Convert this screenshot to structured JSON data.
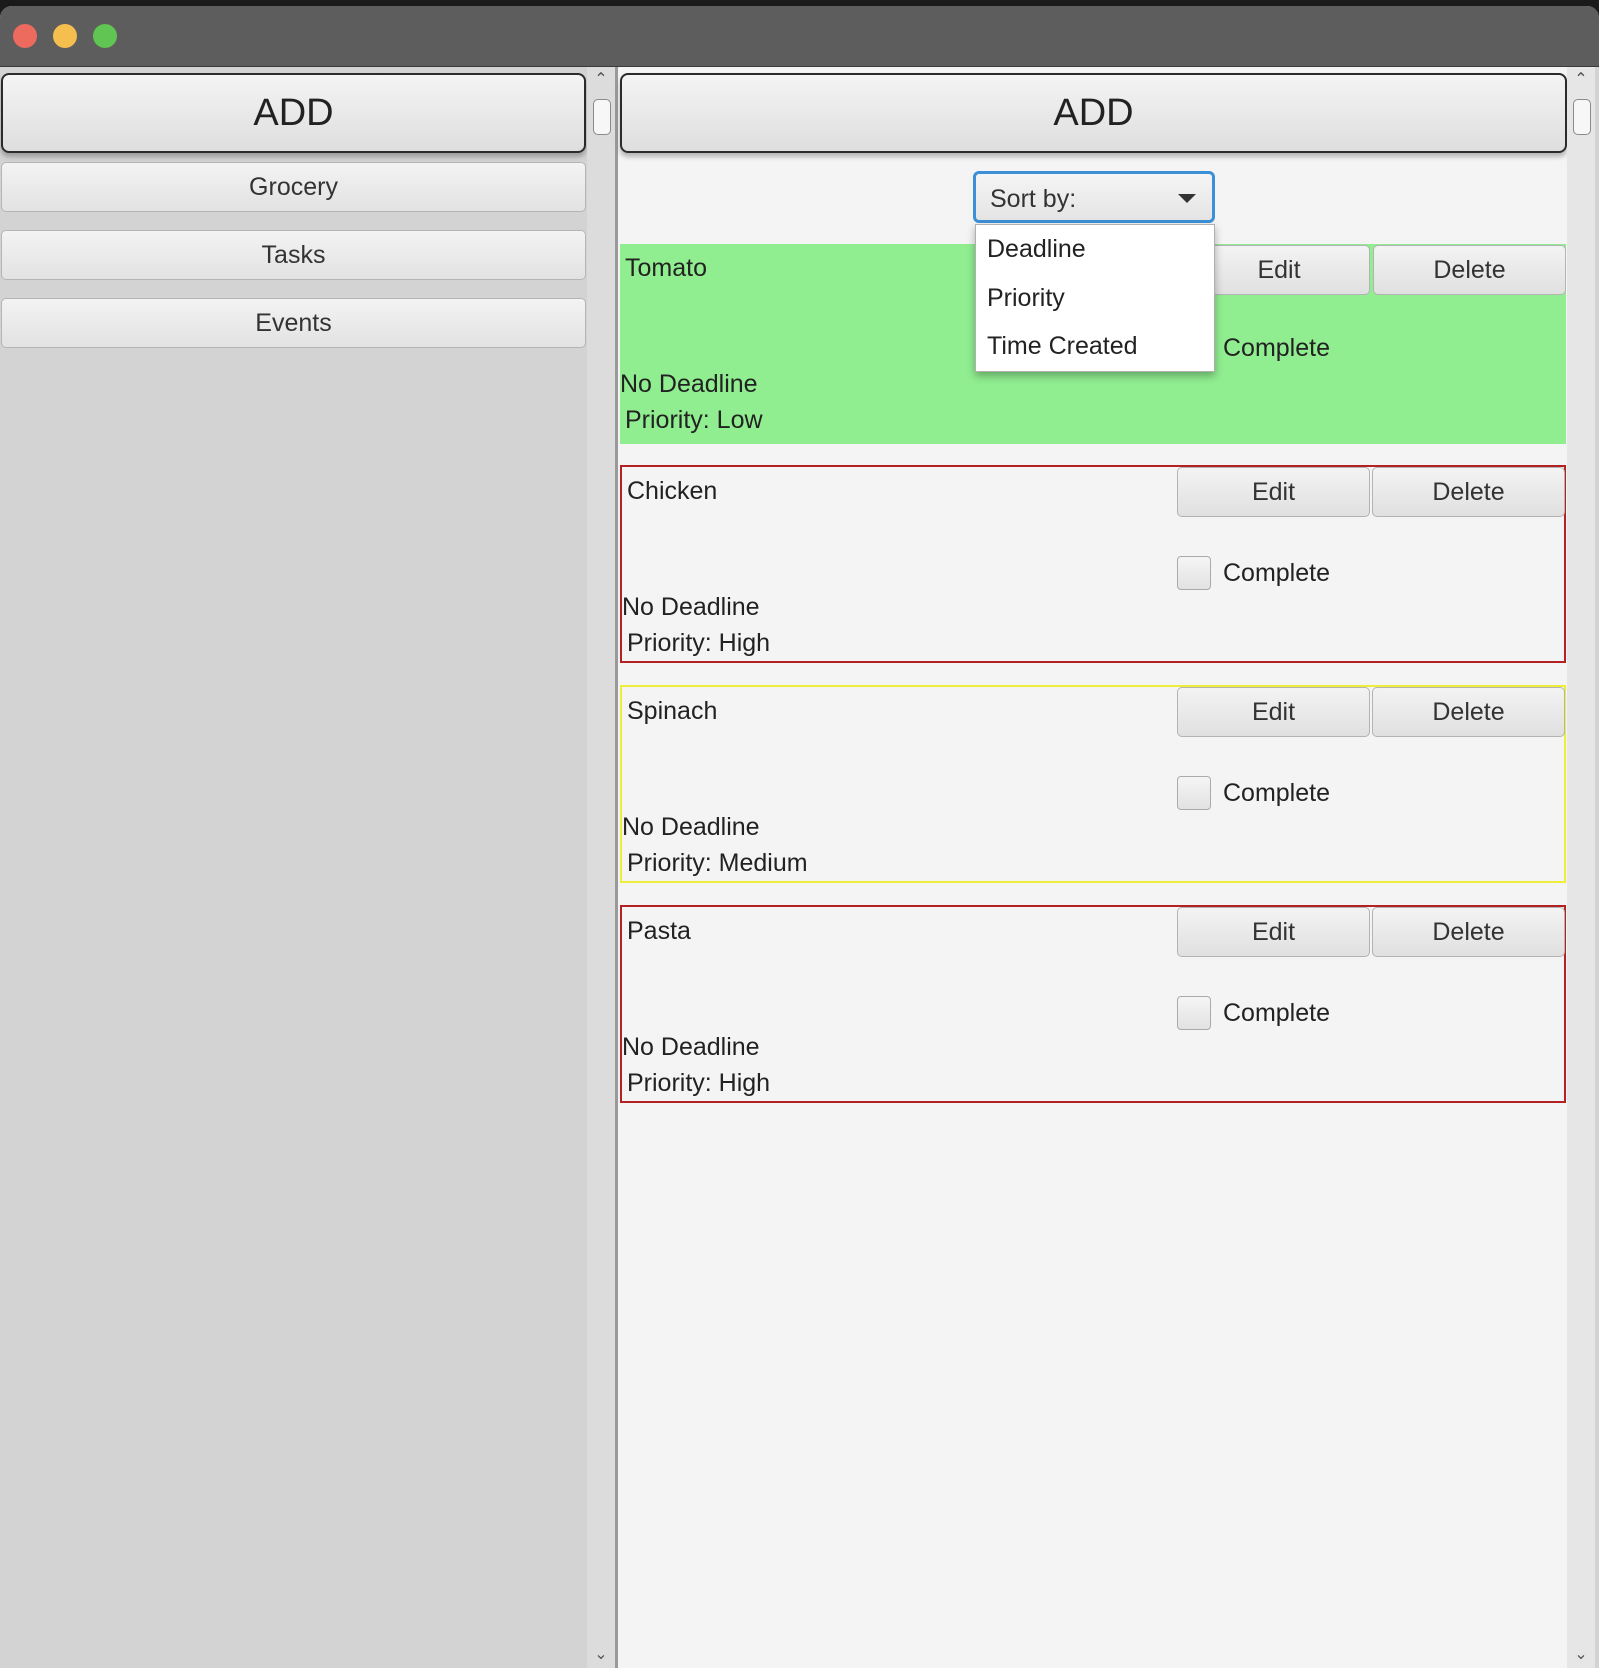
{
  "left_pane": {
    "add_label": "ADD",
    "categories": [
      {
        "label": "Grocery"
      },
      {
        "label": "Tasks"
      },
      {
        "label": "Events"
      }
    ]
  },
  "right_pane": {
    "add_label": "ADD",
    "sort": {
      "label": "Sort by:",
      "options": [
        "Deadline",
        "Priority",
        "Time Created"
      ]
    },
    "items": [
      {
        "title": "Tomato",
        "deadline": "No Deadline",
        "priority": "Priority: Low",
        "complete_label": "Complete",
        "edit_label": "Edit",
        "delete_label": "Delete",
        "status": "completed",
        "border_color": "#90ee90"
      },
      {
        "title": "Chicken",
        "deadline": "No Deadline",
        "priority": "Priority: High",
        "complete_label": "Complete",
        "edit_label": "Edit",
        "delete_label": "Delete",
        "status": "open",
        "border_color": "#b22222"
      },
      {
        "title": "Spinach",
        "deadline": "No Deadline",
        "priority": "Priority: Medium",
        "complete_label": "Complete",
        "edit_label": "Edit",
        "delete_label": "Delete",
        "status": "open",
        "border_color": "#eded3a"
      },
      {
        "title": "Pasta",
        "deadline": "No Deadline",
        "priority": "Priority: High",
        "complete_label": "Complete",
        "edit_label": "Edit",
        "delete_label": "Delete",
        "status": "open",
        "border_color": "#b22222"
      }
    ]
  },
  "colors": {
    "titlebar": "#5d5d5d",
    "close": "#ed6a5e",
    "minimize": "#f5bf4f",
    "maximize": "#61c554",
    "sort_focus": "#3d8fd6",
    "completed_item": "#90ee90"
  }
}
